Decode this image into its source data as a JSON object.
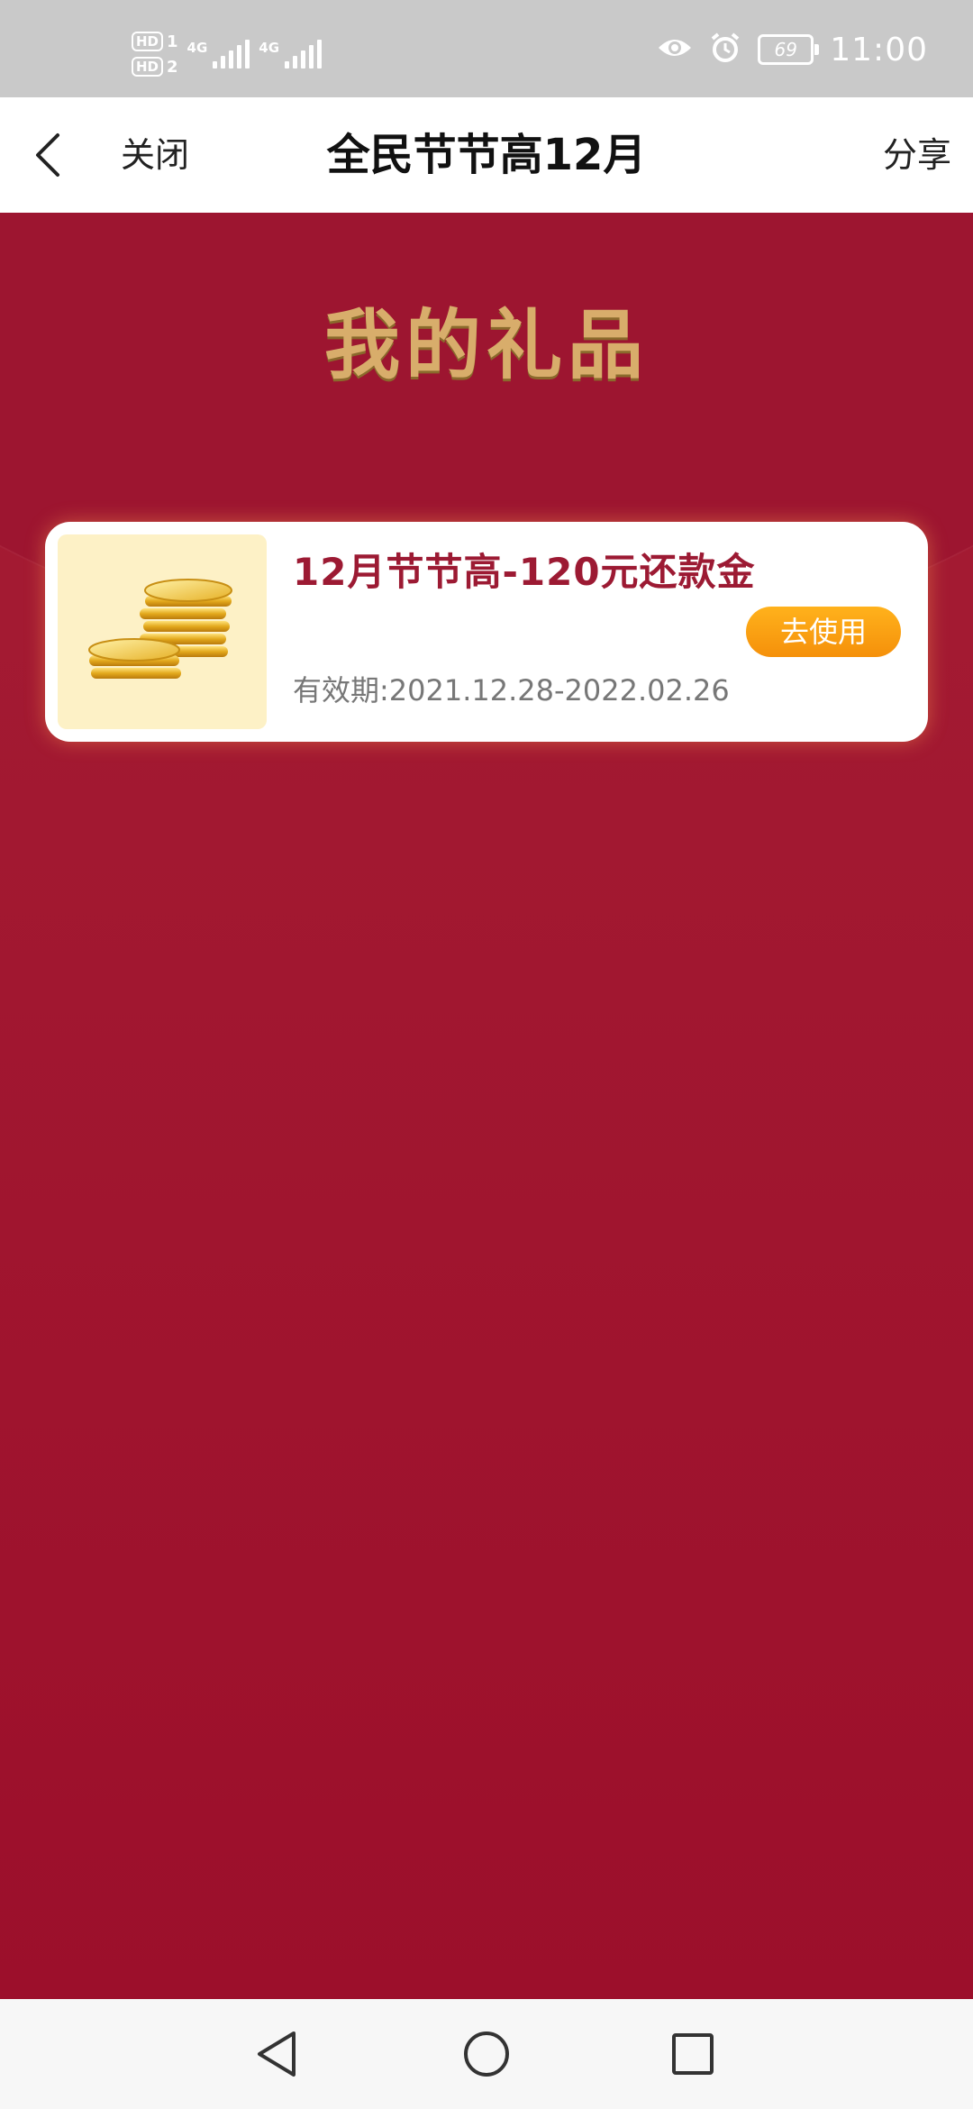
{
  "status_bar": {
    "sim1_label": "HD",
    "sim1_slot": "1",
    "sim2_label": "HD",
    "sim2_slot": "2",
    "network1": "4G",
    "network2": "4G",
    "battery": "69",
    "time": "11:00"
  },
  "nav": {
    "close_label": "关闭",
    "title": "全民节节高12月",
    "share_label": "分享"
  },
  "page": {
    "header_title": "我的礼品"
  },
  "gifts": [
    {
      "title": "12月节节高-120元还款金",
      "validity": "有效期:2021.12.28-2022.02.26",
      "button_label": "去使用",
      "icon": "gold-coins-icon"
    }
  ],
  "colors": {
    "primary_red": "#a01a32",
    "gold_title": "#d8ad6b",
    "button_orange": "#f89f12",
    "gift_title": "#9c1a33"
  }
}
